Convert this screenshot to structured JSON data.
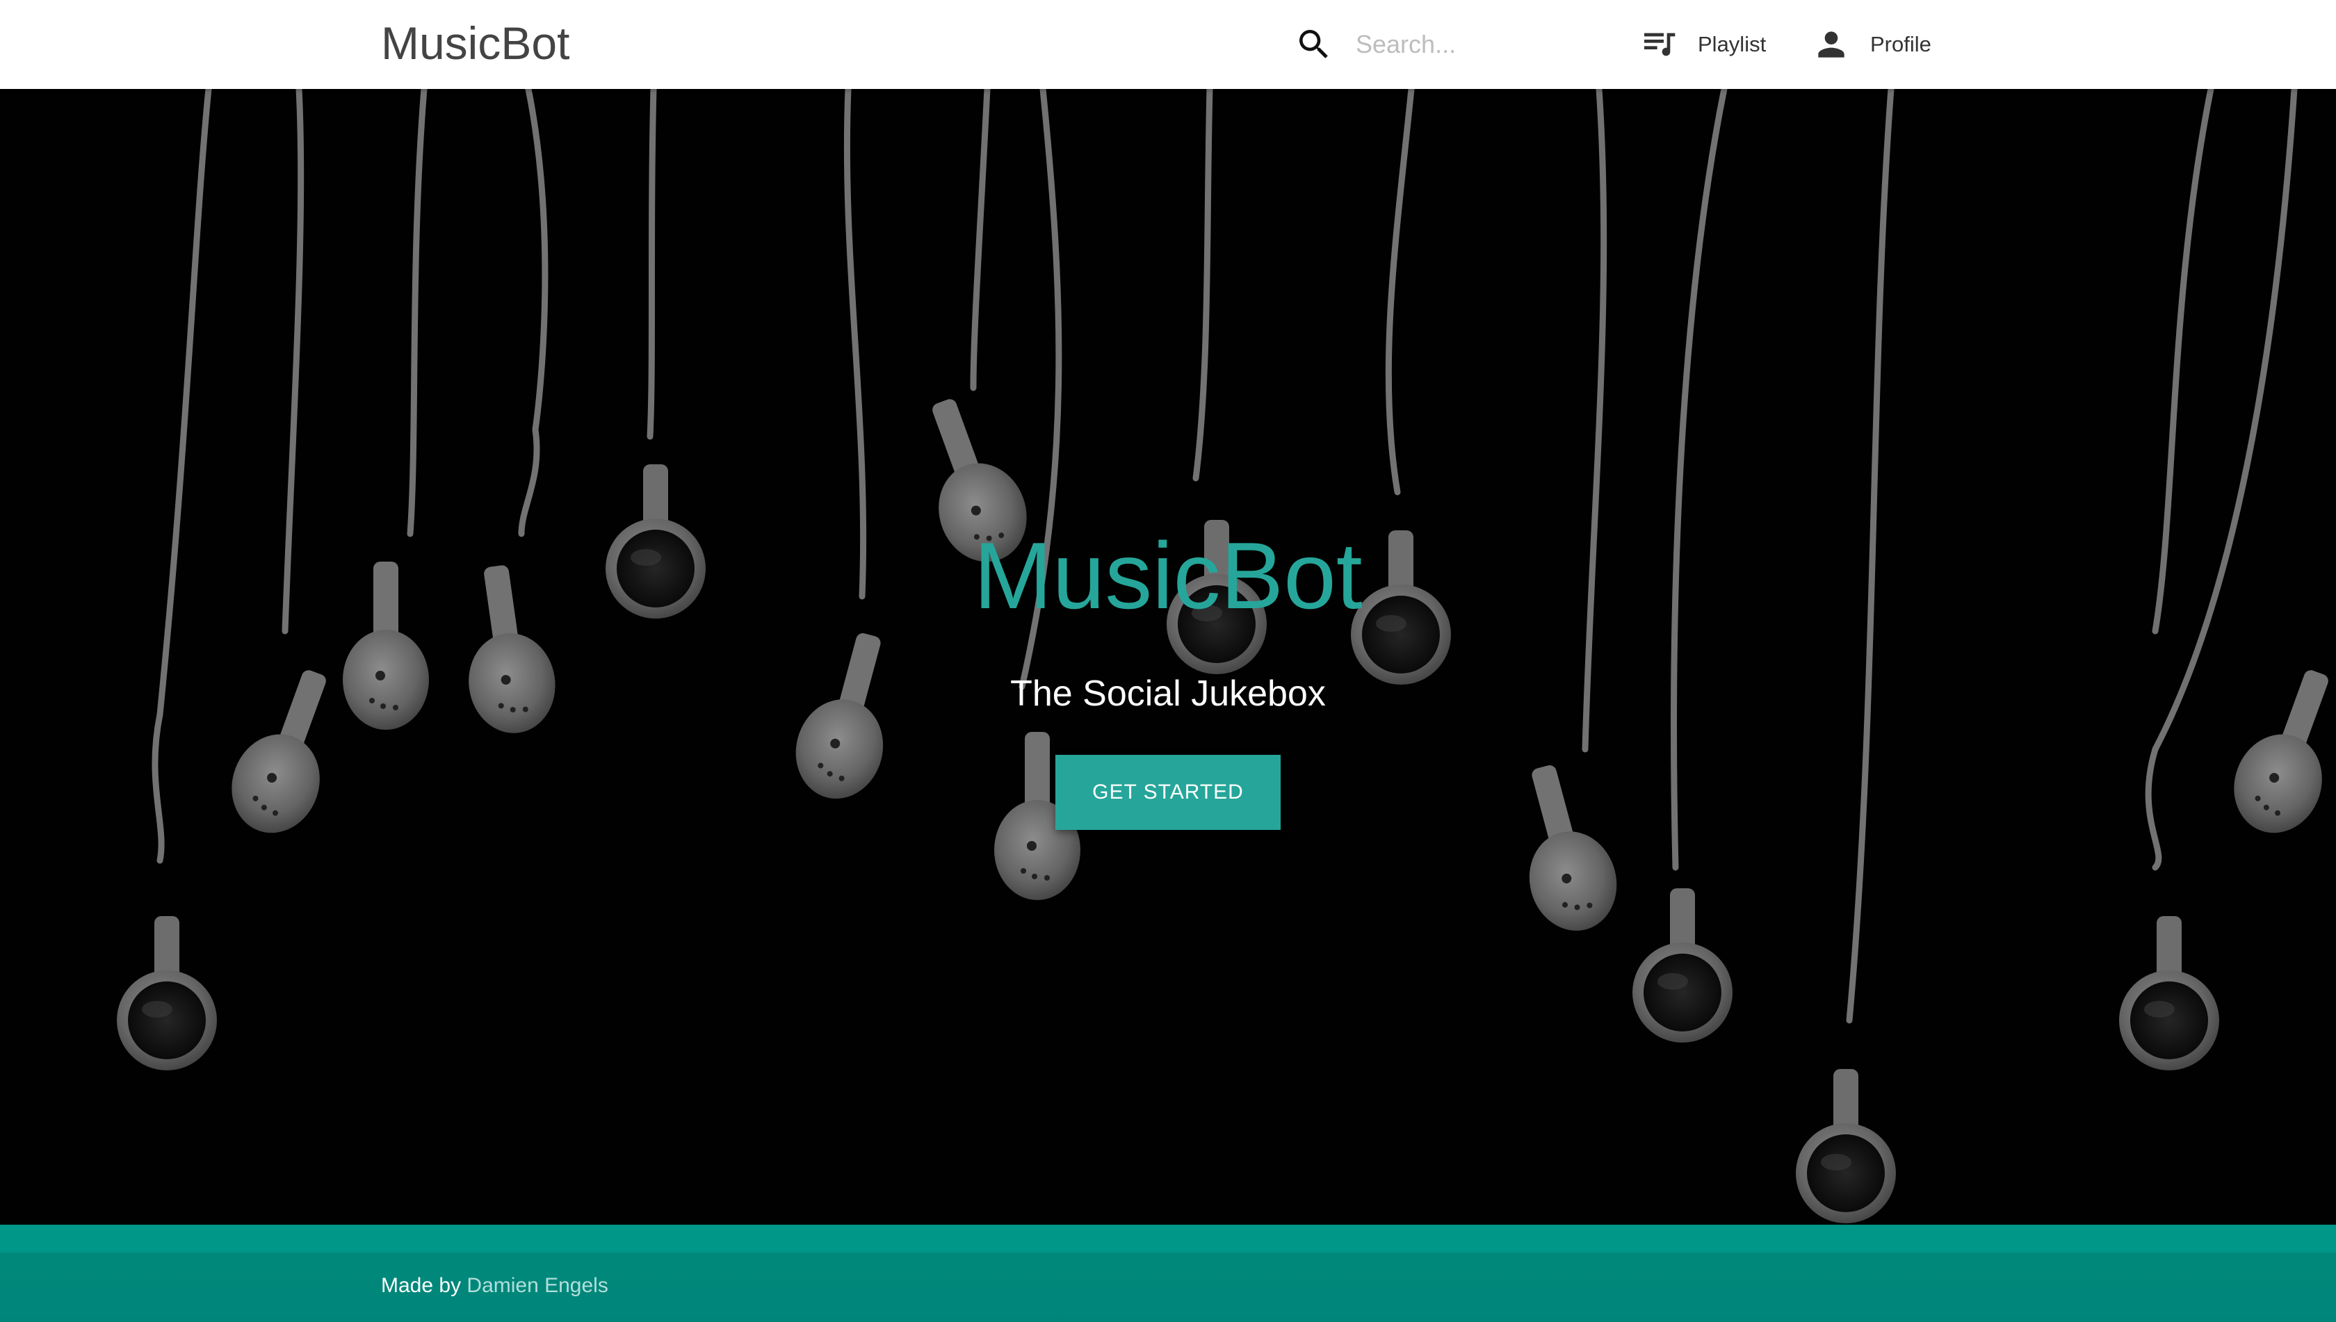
{
  "navbar": {
    "brand": "MusicBot",
    "search": {
      "placeholder": "Search...",
      "value": ""
    },
    "items": [
      {
        "label": "Playlist",
        "icon": "playlist-icon"
      },
      {
        "label": "Profile",
        "icon": "person-icon"
      }
    ]
  },
  "hero": {
    "title": "MusicBot",
    "subtitle": "The Social Jukebox",
    "cta_label": "GET STARTED",
    "background": "hanging-earphones-photo"
  },
  "footer": {
    "prefix": "Made by ",
    "author": "Damien Engels"
  },
  "colors": {
    "accent": "#26a69a",
    "footer": "#009688",
    "navbar": "#ffffff"
  }
}
